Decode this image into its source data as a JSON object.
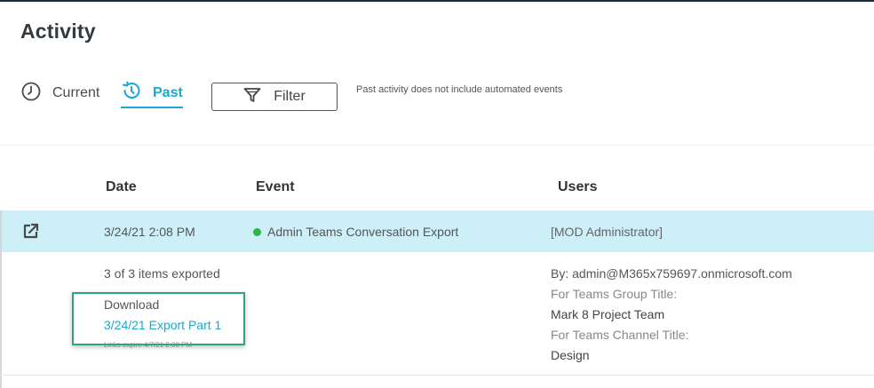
{
  "page": {
    "title": "Activity"
  },
  "tabs": {
    "current_label": "Current",
    "past_label": "Past",
    "active": "Past",
    "accent_color": "#17a9ce"
  },
  "filter": {
    "label": "Filter",
    "icon": "funnel-icon"
  },
  "note": "Past activity does not include automated events",
  "table": {
    "headers": {
      "date": "Date",
      "event": "Event",
      "users": "Users"
    },
    "row": {
      "icon": "export-icon",
      "date": "3/24/21 2:08 PM",
      "status_color": "#2fb34a",
      "event": "Admin Teams Conversation Export",
      "users": "[MOD Administrator]"
    }
  },
  "details": {
    "items_exported": "3 of 3 items exported",
    "download_label": "Download",
    "export_link": "3/24/21 Export Part 1",
    "links_expire": "Links expire 4/7/21 2:08 PM",
    "by": "By: admin@M365x759697.onmicrosoft.com",
    "group_title_label": "For Teams Group Title:",
    "group_title_value": "Mark 8 Project Team",
    "channel_title_label": "For Teams Channel Title:",
    "channel_title_value": "Design"
  }
}
